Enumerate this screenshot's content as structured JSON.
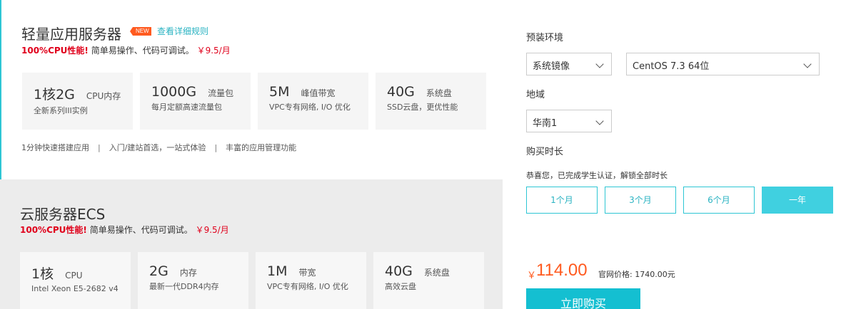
{
  "lightweight": {
    "title": "轻量应用服务器",
    "badge": "NEW",
    "rules_link": "查看详细规则",
    "promo_highlight": "100%CPU性能!",
    "promo_text": "简单易操作、代码可调试。",
    "promo_price": "￥9.5/月",
    "specs": [
      {
        "main": "1核2G",
        "unit": "CPU内存",
        "sub": "全新系列III实例"
      },
      {
        "main": "1000G",
        "unit": "流量包",
        "sub": "每月定额高速流量包"
      },
      {
        "main": "5M",
        "unit": "峰值带宽",
        "sub": "VPC专有网络, I/O 优化"
      },
      {
        "main": "40G",
        "unit": "系统盘",
        "sub": "SSD云盘，更优性能"
      }
    ],
    "features": [
      "1分钟快速搭建应用",
      "入门/建站首选，一站式体验",
      "丰富的应用管理功能"
    ],
    "feature_sep": "|"
  },
  "ecs": {
    "title": "云服务器ECS",
    "promo_highlight": "100%CPU性能!",
    "promo_text": "简单易操作、代码可调试。",
    "promo_price": "￥9.5/月",
    "specs": [
      {
        "main": "1核",
        "unit": "CPU",
        "sub": "Intel Xeon E5-2682 v4"
      },
      {
        "main": "2G",
        "unit": "内存",
        "sub": "最新一代DDR4内存"
      },
      {
        "main": "1M",
        "unit": "带宽",
        "sub": "VPC专有网络, I/O 优化"
      },
      {
        "main": "40G",
        "unit": "系统盘",
        "sub": "高效云盘"
      }
    ]
  },
  "config": {
    "preinstall_label": "预装环境",
    "image_type": "系统镜像",
    "os": "CentOS 7.3 64位",
    "region_label": "地域",
    "region": "华南1",
    "duration_label": "购买时长",
    "student_note": "恭喜您，已完成学生认证，解锁全部时长",
    "durations": [
      "1个月",
      "3个月",
      "6个月",
      "一年"
    ],
    "selected_duration": "一年"
  },
  "pricing": {
    "currency": "￥",
    "price": "114.00",
    "official_label": "官网价格:",
    "official_price": "1740.00元",
    "buy_label": "立即购买"
  },
  "colors": {
    "accent": "#2ec6d4",
    "price": "#ff5a1f",
    "promo": "#e0001b"
  }
}
